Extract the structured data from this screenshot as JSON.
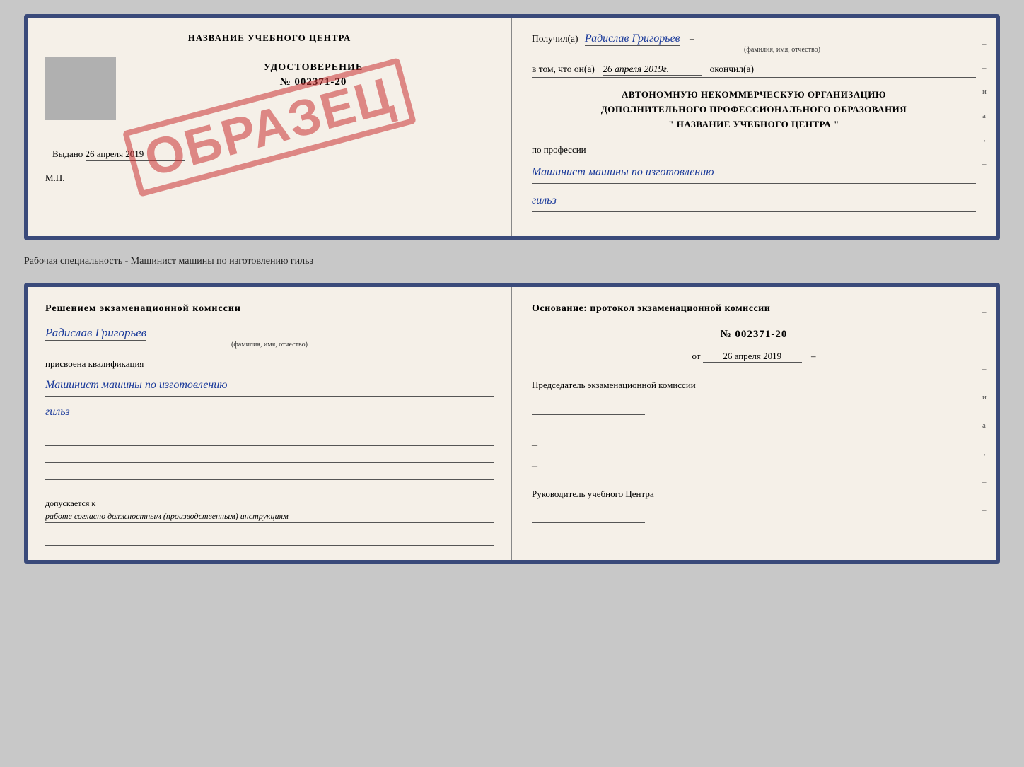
{
  "doc1": {
    "left": {
      "header": "НАЗВАНИЕ УЧЕБНОГО ЦЕНТРА",
      "stamp": "ОБРАЗЕЦ",
      "cert_title": "УДОСТОВЕРЕНИЕ",
      "cert_number": "№ 002371-20",
      "vydano_label": "Выдано",
      "vydano_date": "26 апреля 2019",
      "mp_label": "М.П."
    },
    "right": {
      "poluchil_label": "Получил(a)",
      "recipient_name": "Радислав Григорьев",
      "recipient_subfont": "(фамилия, имя, отчество)",
      "vtom_label": "в том, что он(а)",
      "vtom_date": "26 апреля 2019г.",
      "okonchil": "окончил(а)",
      "org_line1": "АВТОНОМНУЮ НЕКОММЕРЧЕСКУЮ ОРГАНИЗАЦИЮ",
      "org_line2": "ДОПОЛНИТЕЛЬНОГО ПРОФЕССИОНАЛЬНОГО ОБРАЗОВАНИЯ",
      "org_name": "\" НАЗВАНИЕ УЧЕБНОГО ЦЕНТРА \"",
      "profession_label": "по профессии",
      "profession_name": "Машинист машины по изготовлению",
      "profession_name2": "гильз",
      "side_chars": [
        "–",
        "–",
        "и",
        "а",
        "←",
        "–"
      ]
    }
  },
  "specialty_label": "Рабочая специальность - Машинист машины по изготовлению гильз",
  "doc2": {
    "left": {
      "komissia_text": "Решением экзаменационной комиссии",
      "person_name": "Радислав Григорьев",
      "person_subfont": "(фамилия, имя, отчество)",
      "prisvoena_label": "присвоена квалификация",
      "qualification_1": "Машинист машины по изготовлению",
      "qualification_2": "гильз",
      "dopuskaetsya_label": "допускается к",
      "dopuskaetsya_text": "работе согласно должностным (производственным) инструкциям"
    },
    "right": {
      "osnov_header": "Основание: протокол экзаменационной комиссии",
      "protocol_number": "№ 002371-20",
      "ot_label": "от",
      "protocol_date": "26 апреля 2019",
      "predsedatel_title": "Председатель экзаменационной комиссии",
      "rukovoditel_title": "Руководитель учебного Центра",
      "side_chars": [
        "–",
        "–",
        "–",
        "и",
        "а",
        "←",
        "–",
        "–",
        "–"
      ]
    }
  }
}
